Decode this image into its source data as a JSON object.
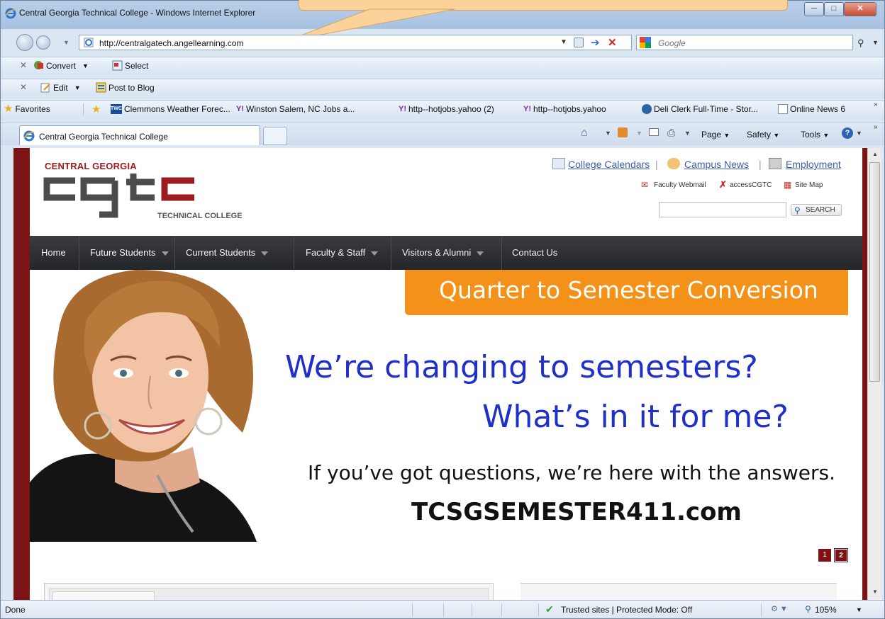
{
  "window": {
    "title": "Central Georgia Technical College - Windows Internet Explorer"
  },
  "address": {
    "url": "http://centralgatech.angellearning.com"
  },
  "search": {
    "placeholder": "Google"
  },
  "toolbars": {
    "convert_label": "Convert",
    "select_label": "Select",
    "edit_label": "Edit",
    "post_label": "Post to Blog"
  },
  "favorites": {
    "label": "Favorites",
    "items": [
      "Clemmons Weather Forec...",
      "Winston Salem, NC Jobs a...",
      "http--hotjobs.yahoo (2)",
      "http--hotjobs.yahoo",
      "Deli Clerk Full-Time - Stor...",
      "Online News 6"
    ]
  },
  "tab": {
    "label": "Central Georgia Technical College"
  },
  "commands": {
    "page": "Page",
    "safety": "Safety",
    "tools": "Tools"
  },
  "site": {
    "logo_top": "CENTRAL GEORGIA",
    "logo_letters": "cgtc",
    "logo_bottom": "TECHNICAL COLLEGE",
    "header_links": [
      "College Calendars",
      "Campus News",
      "Employment"
    ],
    "secondary_links": [
      "Faculty Webmail",
      "accessCGTC",
      "Site Map"
    ],
    "search_button": "SEARCH",
    "nav": [
      "Home",
      "Future Students",
      "Current Students",
      "Faculty & Staff",
      "Visitors & Alumni",
      "Contact Us"
    ]
  },
  "banner": {
    "orange_title": "Quarter to Semester Conversion",
    "headline1": "We’re changing to semesters?",
    "headline2": "What’s in it for me?",
    "subline": "If you’ve got questions, we’re here with the answers.",
    "url": "TCSGSEMESTER411.com",
    "pages": [
      "1",
      "2"
    ]
  },
  "status": {
    "text": "Done",
    "zone": "Trusted sites | Protected Mode: Off",
    "zoom": "105%"
  },
  "colors": {
    "brand_red": "#7f1214",
    "banner_orange": "#f39119",
    "headline_blue": "#1f2fc9",
    "nav_dark": "#2b2d31"
  }
}
